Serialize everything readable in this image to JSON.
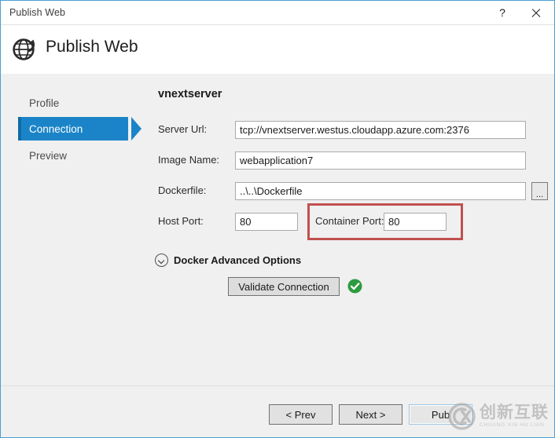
{
  "window": {
    "title": "Publish Web",
    "help_icon": "question-mark-icon",
    "close_icon": "close-icon",
    "accent_border": "#4a9fd4"
  },
  "header": {
    "title": "Publish Web",
    "icon": "globe-publish-icon"
  },
  "sidebar": {
    "items": [
      {
        "label": "Profile",
        "selected": false
      },
      {
        "label": "Connection",
        "selected": true
      },
      {
        "label": "Preview",
        "selected": false
      }
    ],
    "selected_color": "#1b84c8"
  },
  "content": {
    "heading": "vnextserver",
    "fields": {
      "server_url": {
        "label": "Server Url:",
        "value": "tcp://vnextserver.westus.cloudapp.azure.com:2376"
      },
      "image_name": {
        "label": "Image Name:",
        "value": "webapplication7"
      },
      "dockerfile": {
        "label": "Dockerfile:",
        "value": "..\\..\\Dockerfile",
        "browse_label": "..."
      },
      "host_port": {
        "label": "Host Port:",
        "value": "80"
      },
      "container_port": {
        "label": "Container Port:",
        "value": "80",
        "highlight_color": "#c0504d"
      }
    },
    "advanced_options": {
      "label": "Docker Advanced Options",
      "icon": "chevron-down-circle-icon"
    },
    "validate": {
      "label": "Validate Connection",
      "status_icon": "green-check-circle-icon",
      "status_color": "#2d9b3f"
    }
  },
  "footer": {
    "buttons": [
      {
        "label": "< Prev"
      },
      {
        "label": "Next >"
      },
      {
        "label": "Pub"
      }
    ]
  },
  "watermark": {
    "chinese": "创新互联",
    "pinyin": "CHUANG XIN HU LIAN",
    "logo": "cx-circle-logo"
  }
}
